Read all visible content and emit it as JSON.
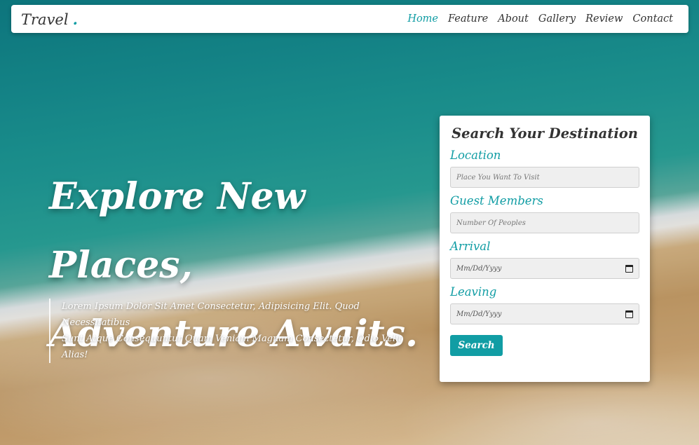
{
  "header": {
    "logo": "Travel",
    "logo_dot": ".",
    "nav": [
      "Home",
      "Feature",
      "About",
      "Gallery",
      "Review",
      "Contact"
    ]
  },
  "hero": {
    "title_line1": "Explore New Places,",
    "title_line2": "Adventure Awaits.",
    "description_line1": "Lorem Ipsum Dolor Sit Amet Consectetur, Adipisicing Elit. Quod Necessitatibus",
    "description_line2": "Sunt Atque Consequuntur Quam Veniam Magnam Consectetur, Odio Velit Alias!"
  },
  "search": {
    "title": "Search Your Destination",
    "location_label": "Location",
    "location_placeholder": "Place You Want To Visit",
    "guests_label": "Guest Members",
    "guests_placeholder": "Number Of Peoples",
    "arrival_label": "Arrival",
    "arrival_value": "Mm/Dd/Yyyy",
    "leaving_label": "Leaving",
    "leaving_value": "Mm/Dd/Yyyy",
    "button": "Search"
  },
  "colors": {
    "accent": "#119da4",
    "text": "#333333"
  }
}
